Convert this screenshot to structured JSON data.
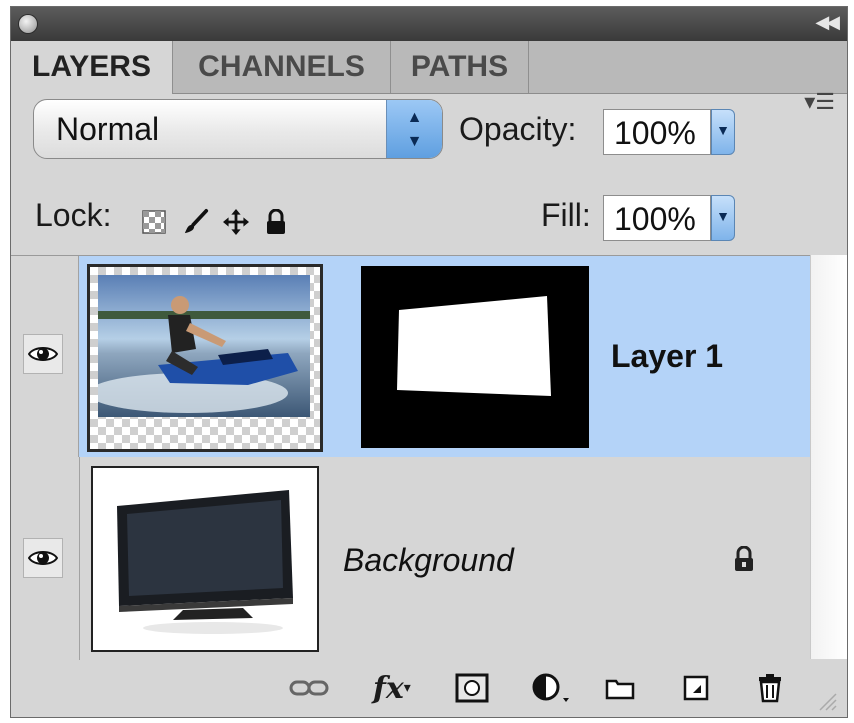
{
  "tabs": [
    {
      "label": "LAYERS",
      "active": true
    },
    {
      "label": "CHANNELS",
      "active": false
    },
    {
      "label": "PATHS",
      "active": false
    }
  ],
  "blend_mode": {
    "value": "Normal"
  },
  "opacity": {
    "label": "Opacity:",
    "value": "100%"
  },
  "lock": {
    "label": "Lock:"
  },
  "fill": {
    "label": "Fill:",
    "value": "100%"
  },
  "layers": [
    {
      "name": "Layer 1",
      "selected": true,
      "visible": true,
      "has_mask": true
    },
    {
      "name": "Background",
      "selected": false,
      "visible": true,
      "locked": true
    }
  ],
  "icons": [
    "close-icon",
    "collapse-icon",
    "panel-menu-icon",
    "lock-transparent-icon",
    "lock-paint-icon",
    "lock-move-icon",
    "lock-all-icon",
    "eye-icon",
    "link-icon",
    "fx-icon",
    "mask-icon",
    "adjustment-icon",
    "folder-icon",
    "new-layer-icon",
    "trash-icon"
  ],
  "colors": {
    "selected_row": "#b4d3f8",
    "panel": "#d6d6d6",
    "tabbar": "#b9b9b9"
  }
}
